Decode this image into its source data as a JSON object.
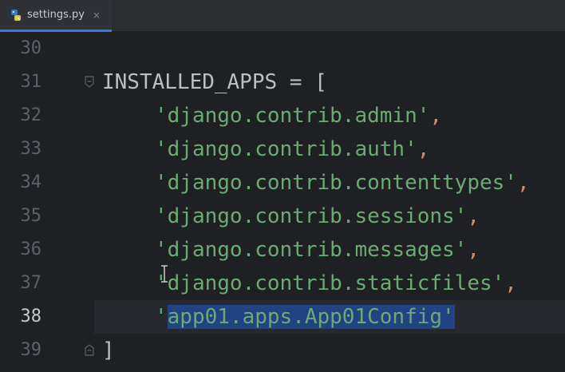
{
  "tab": {
    "filename": "settings.py",
    "close_glyph": "×",
    "icon": "python-file-icon"
  },
  "editor": {
    "lines": [
      {
        "number": "30",
        "text": ""
      },
      {
        "number": "31",
        "text": "INSTALLED_APPS = ["
      },
      {
        "number": "32",
        "text": "'django.contrib.admin',"
      },
      {
        "number": "33",
        "text": "'django.contrib.auth',"
      },
      {
        "number": "34",
        "text": "'django.contrib.contenttypes',"
      },
      {
        "number": "35",
        "text": "'django.contrib.sessions',"
      },
      {
        "number": "36",
        "text": "'django.contrib.messages',"
      },
      {
        "number": "37",
        "text": "'django.contrib.staticfiles',"
      },
      {
        "number": "38",
        "text": "'app01.apps.App01Config'"
      },
      {
        "number": "39",
        "text": "]"
      }
    ],
    "current_line": "38",
    "selected_text": "app01.apps.App01Config'"
  },
  "colors": {
    "background": "#1f2023",
    "string": "#6aab73",
    "punctuation": "#cf8e6d",
    "identifier": "#bcbec4",
    "selection": "#214283",
    "tab_accent": "#3574f0"
  }
}
